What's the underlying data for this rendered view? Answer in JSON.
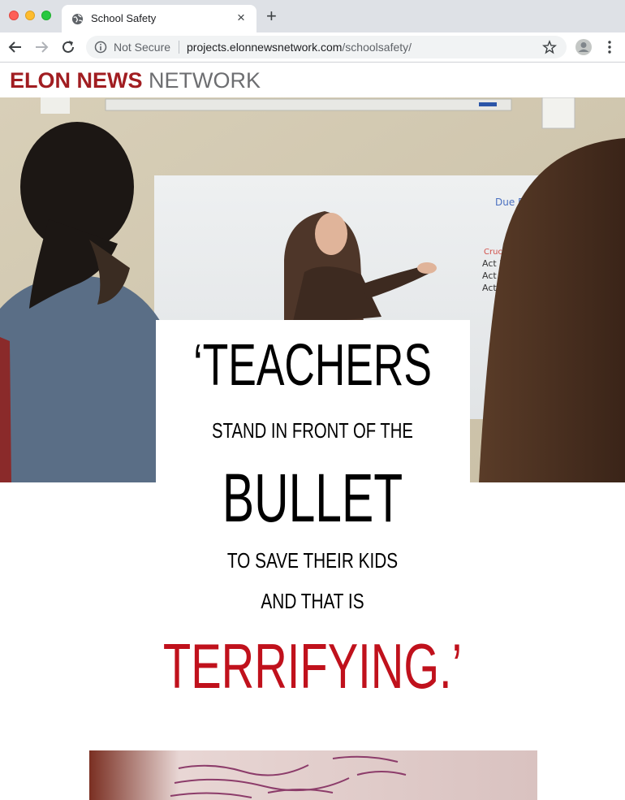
{
  "browser": {
    "tab_title": "School Safety",
    "tab_close": "×",
    "new_tab": "+",
    "security_label": "Not Secure",
    "url_host": "projects.elonnewsnetwork.com",
    "url_path": "/schoolsafety/"
  },
  "site": {
    "logo_bold": "ELON NEWS",
    "logo_light": " NETWORK",
    "brand_color": "#a11d21"
  },
  "hero": {
    "whiteboard_text": {
      "heading": "Due Dates",
      "sub": "Crucible Quiz",
      "line1": "Act 2 - Fri",
      "line2": "Act 3 - Wed",
      "line3": "Act 4 - Fri"
    }
  },
  "quote": {
    "line1": "‘TEACHERS",
    "line2": "STAND IN FRONT OF THE",
    "line3": "BULLET",
    "line4": "TO SAVE THEIR KIDS",
    "line5": "AND THAT IS",
    "line6": "TERRIFYING.’",
    "accent_color": "#c0111c"
  }
}
